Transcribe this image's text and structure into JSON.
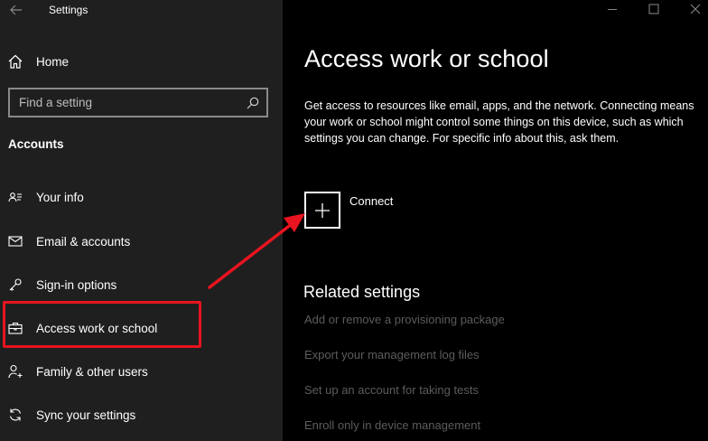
{
  "window": {
    "title": "Settings",
    "accent_color": "#e8141f"
  },
  "sidebar": {
    "home_label": "Home",
    "search_placeholder": "Find a setting",
    "section_title": "Accounts",
    "items": [
      {
        "label": "Your info",
        "icon": "person-card-icon"
      },
      {
        "label": "Email & accounts",
        "icon": "envelope-icon"
      },
      {
        "label": "Sign-in options",
        "icon": "key-icon"
      },
      {
        "label": "Access work or school",
        "icon": "briefcase-icon"
      },
      {
        "label": "Family & other users",
        "icon": "add-person-icon"
      },
      {
        "label": "Sync your settings",
        "icon": "sync-icon"
      }
    ]
  },
  "main": {
    "title": "Access work or school",
    "description": "Get access to resources like email, apps, and the network. Connecting means your work or school might control some things on this device, such as which settings you can change. For specific info about this, ask them.",
    "connect_label": "Connect",
    "related_title": "Related settings",
    "related_links": [
      "Add or remove a provisioning package",
      "Export your management log files",
      "Set up an account for taking tests",
      "Enroll only in device management"
    ]
  }
}
